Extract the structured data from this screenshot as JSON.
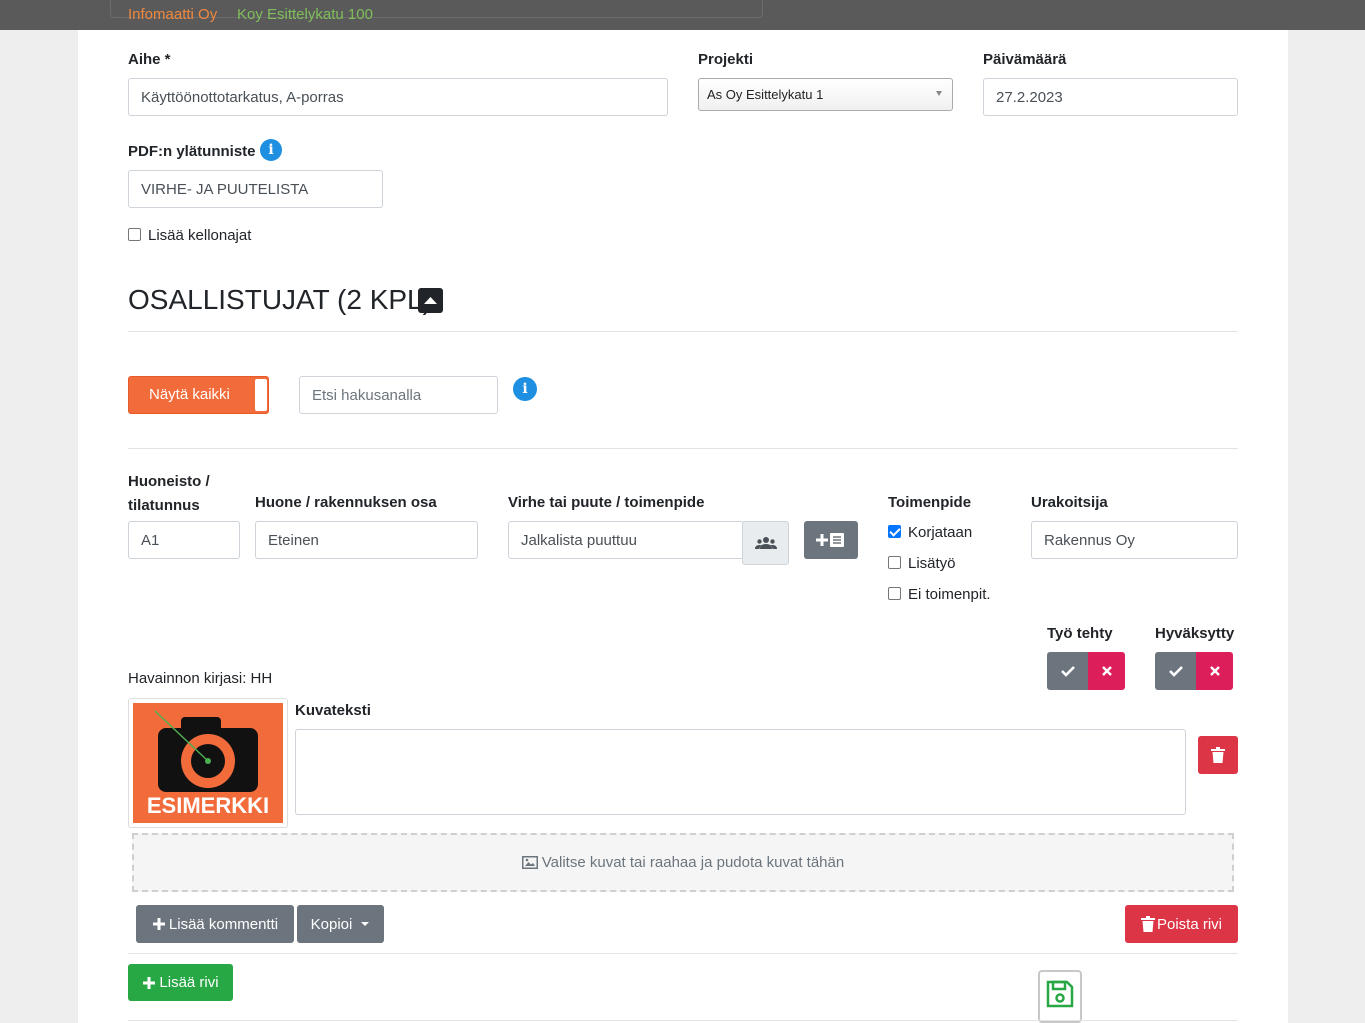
{
  "topbar": {
    "company": "Infomaatti Oy",
    "property": "Koy Esittelykatu 100"
  },
  "form": {
    "subject_label": "Aihe *",
    "subject_value": "Käyttöönottotarkatus, A-porras",
    "project_label": "Projekti",
    "project_value": "As Oy Esittelykatu 1",
    "date_label": "Päivämäärä",
    "date_value": "27.2.2023",
    "pdf_header_label": "PDF:n ylätunniste",
    "pdf_header_value": "VIRHE- JA PUUTELISTA",
    "add_times_label": "Lisää kellonajat",
    "add_times_checked": false
  },
  "participants": {
    "heading": "OSALLISTUJAT (2 KPL)",
    "show_all_label": "Näytä kaikki",
    "search_placeholder": "Etsi hakusanalla"
  },
  "row": {
    "apartment_label_line1": "Huoneisto /",
    "apartment_label_line2": "tilatunnus",
    "apartment_value": "A1",
    "room_label": "Huone / rakennuksen osa",
    "room_value": "Eteinen",
    "defect_label": "Virhe tai puute / toimenpide",
    "defect_value": "Jalkalista puuttuu",
    "action_label": "Toimenpide",
    "actions": [
      {
        "label": "Korjataan",
        "checked": true
      },
      {
        "label": "Lisätyö",
        "checked": false
      },
      {
        "label": "Ei toimenpit.",
        "checked": false
      }
    ],
    "contractor_label": "Urakoitsija",
    "contractor_value": "Rakennus Oy",
    "work_done_label": "Työ tehty",
    "approved_label": "Hyväksytty",
    "recorded_by": "Havainnon kirjasi: HH",
    "image_caption_label": "Kuvateksti",
    "image_caption_value": "",
    "image_text": "ESIMERKKI",
    "dropzone_text": "Valitse kuvat tai raahaa ja pudota kuvat tähän",
    "add_comment_label": "Lisää kommentti",
    "copy_label": "Kopioi",
    "delete_row_label": "Poista rivi"
  },
  "footer": {
    "add_row_label": "Lisää rivi"
  },
  "colors": {
    "orange": "#f26c3b",
    "green": "#28a745",
    "red": "#dc3545",
    "gray": "#6c757d",
    "pink": "#dc1e5a",
    "info": "#1e8fe1"
  },
  "icons": [
    "info-icon",
    "caret-up-icon",
    "users-icon",
    "add-list-icon",
    "check-icon",
    "close-icon",
    "trash-icon",
    "image-icon",
    "plus-icon",
    "caret-down-icon",
    "save-icon",
    "camera-icon"
  ]
}
